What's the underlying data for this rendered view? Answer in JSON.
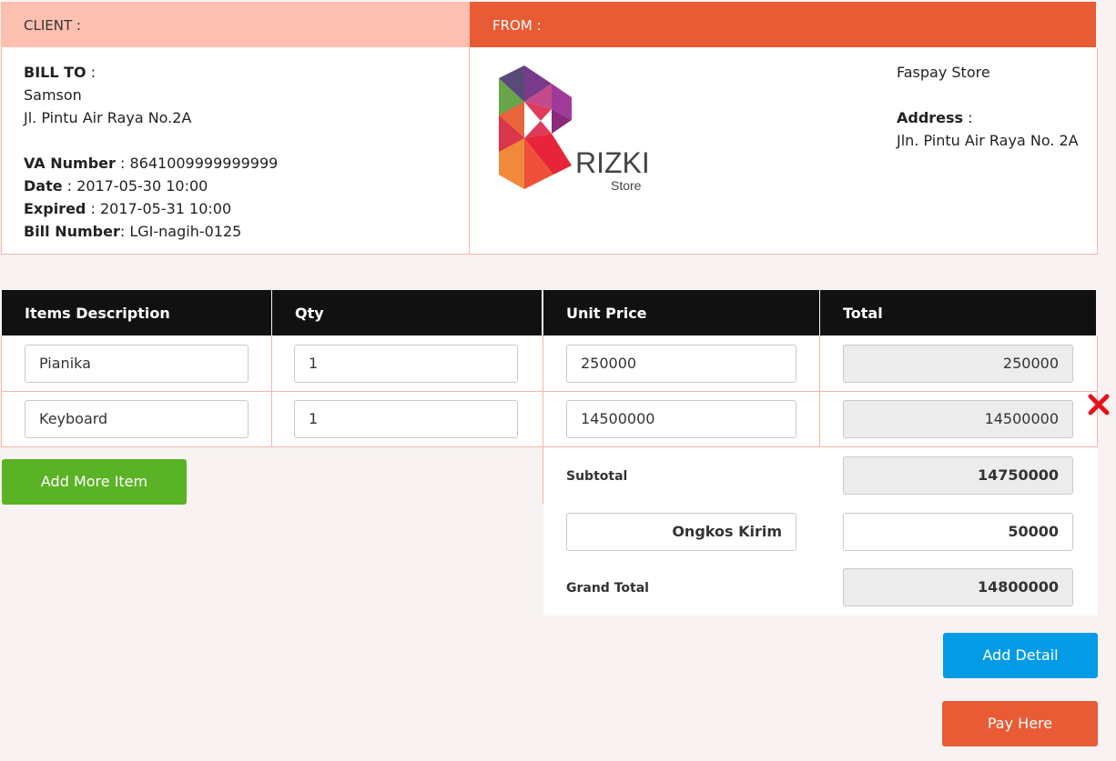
{
  "client": {
    "header": "CLIENT :",
    "bill_to_label": "BILL TO",
    "bill_to_sep": " :",
    "name": "Samson",
    "address": "Jl. Pintu Air Raya No.2A",
    "va_label": "VA Number",
    "va_value": " : 8641009999999999",
    "date_label": "Date",
    "date_value": " : 2017-05-30 10:00",
    "expired_label": "Expired",
    "expired_value": " : 2017-05-31 10:00",
    "bill_number_label": "Bill Number",
    "bill_number_value": ": LGI-nagih-0125"
  },
  "from": {
    "header": "FROM :",
    "logo_text": "RIZKI",
    "logo_sub": "Store",
    "store_name": "Faspay Store",
    "address_label": "Address",
    "address_sep": " :",
    "address": "Jln. Pintu Air Raya No. 2A"
  },
  "table": {
    "headers": [
      "Items Description",
      "Qty",
      "Unit Price",
      "Total"
    ],
    "rows": [
      {
        "description": "Pianika",
        "qty": "1",
        "unit_price": "250000",
        "total": "250000"
      },
      {
        "description": "Keyboard",
        "qty": "1",
        "unit_price": "14500000",
        "total": "14500000"
      }
    ]
  },
  "summary": {
    "subtotal_label": "Subtotal",
    "subtotal_value": "14750000",
    "shipping_label": "Ongkos Kirim",
    "shipping_value": "50000",
    "grand_total_label": "Grand Total",
    "grand_total_value": "14800000"
  },
  "buttons": {
    "add_more_item": "Add More Item",
    "add_detail": "Add Detail",
    "pay_here": "Pay Here"
  },
  "icons": {
    "remove_row": "close-icon"
  },
  "colors": {
    "client_header": "#fdbfb0",
    "from_header": "#e85b34",
    "table_header": "#121111",
    "add_item_button": "#5ab225",
    "add_detail_button": "#039be5",
    "pay_button": "#e85b34",
    "remove_icon": "#e8121c"
  }
}
